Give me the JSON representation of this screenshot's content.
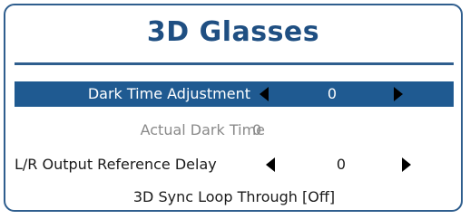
{
  "dialog": {
    "title": "3D Glasses"
  },
  "menu": {
    "dark_time_adjustment": {
      "label": "Dark Time Adjustment",
      "value": "0"
    },
    "actual_dark_time": {
      "label": "Actual Dark Time",
      "value": "0"
    },
    "output_reference_delay": {
      "label": "L/R Output Reference Delay",
      "value": "0"
    },
    "sync_loop_through": {
      "label": "3D Sync Loop Through [Off]"
    }
  },
  "colors": {
    "title": "#1f4f82",
    "selected_row": "#1f5a91",
    "border": "#2f5e8e",
    "disabled_text": "#8a8a8a"
  },
  "icons": {
    "decrease": "triangle-left",
    "increase": "triangle-right"
  }
}
